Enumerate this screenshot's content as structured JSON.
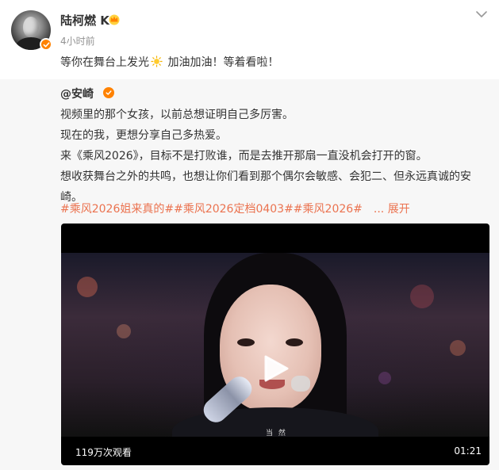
{
  "post": {
    "username": "陆柯燃 K",
    "time": "4小时前",
    "text_before": "等你在舞台上发光",
    "text_after": " 加油加油！等着看啦！",
    "icons": {
      "verified": "verified-badge-icon",
      "crown": "crown-icon",
      "sun": "sun-emoji-icon",
      "menu": "chevron-down-icon"
    }
  },
  "repost": {
    "author": "@安崎",
    "lines": [
      "视频里的那个女孩，以前总想证明自己多厉害。",
      "现在的我，更想分享自己多热爱。",
      "来《乘风2026》，目标不是打败谁，而是去推开那扇一直没机会打开的窗。",
      "想收获舞台之外的共鸣，也想让你们看到那个偶尔会敏感、会犯二、但永远真诚的安",
      "崎。"
    ],
    "tags": "#乘风2026姐来真的##乘风2026定档0403##乘风2026#",
    "more_label": "... 展开"
  },
  "video": {
    "views": "119万次观看",
    "duration": "01:21",
    "subtitle": "当 然"
  },
  "colors": {
    "accent_orange": "#ff8200",
    "tag_color": "#eb7350",
    "repost_bg": "#f7f7f7"
  }
}
